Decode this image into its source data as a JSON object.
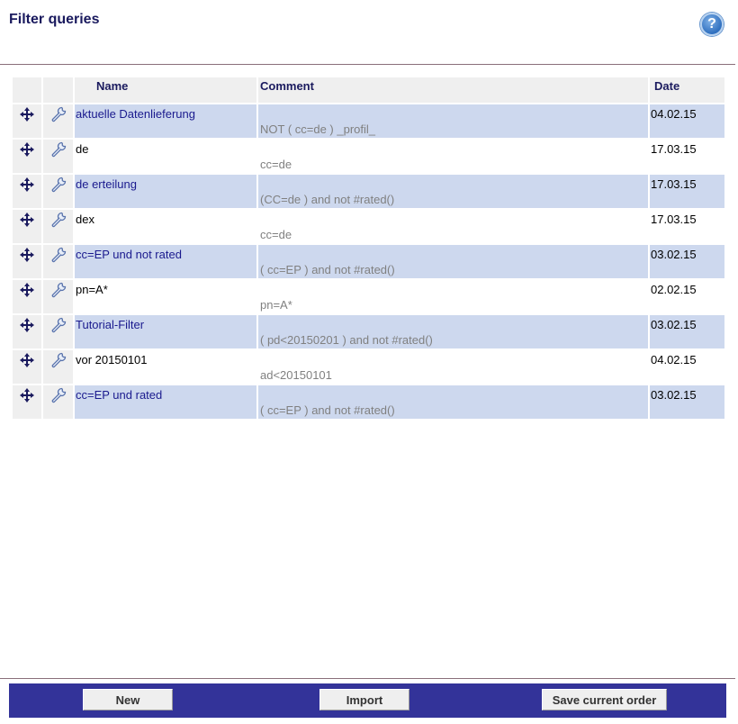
{
  "header": {
    "title": "Filter queries",
    "help_label": "?"
  },
  "columns": {
    "name": "Name",
    "comment": "Comment",
    "date": "Date"
  },
  "rows": [
    {
      "name": "aktuelle Datenlieferung",
      "comment": "NOT ( cc=de ) _profil_",
      "date": "04.02.15"
    },
    {
      "name": "de",
      "comment": "cc=de",
      "date": "17.03.15"
    },
    {
      "name": "de erteilung",
      "comment": "(CC=de ) and not #rated()",
      "date": "17.03.15"
    },
    {
      "name": "dex",
      "comment": "cc=de",
      "date": "17.03.15"
    },
    {
      "name": "cc=EP und not rated",
      "comment": "( cc=EP ) and not #rated()",
      "date": "03.02.15"
    },
    {
      "name": "pn=A*",
      "comment": "pn=A*",
      "date": "02.02.15"
    },
    {
      "name": "Tutorial-Filter",
      "comment": "( pd<20150201 ) and not #rated()",
      "date": "03.02.15"
    },
    {
      "name": "vor 20150101",
      "comment": "ad<20150101",
      "date": "04.02.15"
    },
    {
      "name": "cc=EP und rated",
      "comment": "( cc=EP ) and not #rated()",
      "date": "03.02.15"
    }
  ],
  "icons": {
    "move": "move-arrows-icon",
    "edit": "wrench-icon"
  },
  "footer": {
    "new_label": "New",
    "import_label": "Import",
    "save_order_label": "Save current order"
  },
  "colors": {
    "row_highlight": "#cdd8ee",
    "footer_bar": "#333399",
    "header_text": "#1a1a5e"
  }
}
